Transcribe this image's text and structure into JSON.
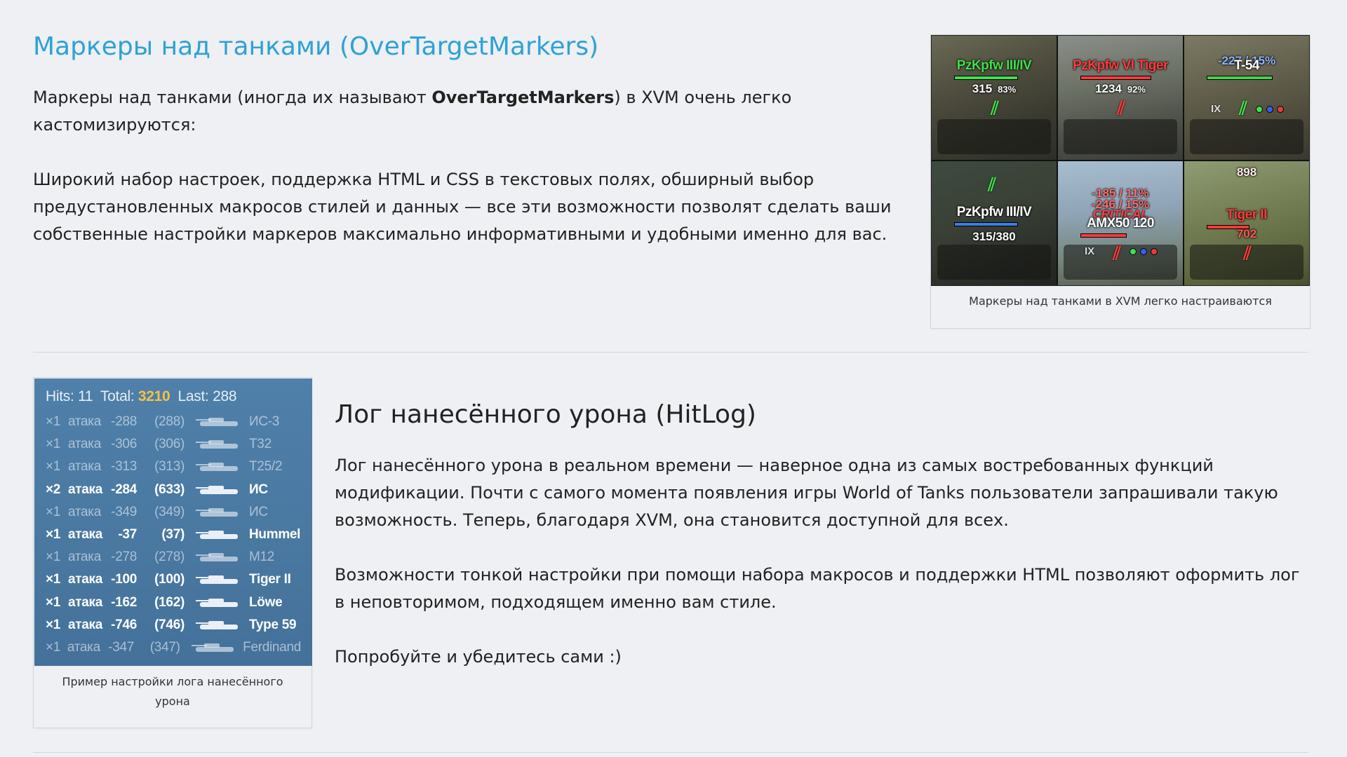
{
  "markers_section": {
    "title": "Маркеры над танками (OverTargetMarkers)",
    "para1_before": "Маркеры над танками (иногда их называют ",
    "para1_bold": "OverTargetMarkers",
    "para1_after": ") в XVM очень легко кастомизируются:",
    "para2": "Широкий набор настроек, поддержка HTML и CSS в текстовых полях, обширный выбор предустановленных макросов стилей и данных — все эти возможности позволят сделать ваши собственные настройки маркеров максимально информативными и удобными именно для вас.",
    "figure_caption": "Маркеры над танками в XVM легко настраиваются",
    "cells": [
      {
        "name": "PzKpfw III/IV",
        "sub": "315",
        "pct": "83%",
        "name_color": "#3fe04a",
        "bar_color": "#3fe04a",
        "bar_fill": 0.83
      },
      {
        "name": "PzKpfw VI Tiger",
        "sub": "1234",
        "pct": "92%",
        "name_color": "#ff3b3b",
        "bar_color": "#ff3b3b",
        "bar_fill": 0.92
      },
      {
        "name": "T-54",
        "sub": "-227 / 15%",
        "pct": "",
        "name_color": "#ffffff",
        "bar_color": "#49d04a",
        "bar_fill": 0.85,
        "tier": "IX"
      },
      {
        "name": "PzKpfw III/IV",
        "sub": "315/380",
        "pct": "",
        "name_color": "#ffffff",
        "bar_color": "#3b7fe8",
        "bar_fill": 0.83
      },
      {
        "name": "AMX50 120",
        "sub": "-185 / 11%",
        "sub2": "-246 / 15%",
        "crit": "CRITICAL",
        "pct": "",
        "name_color": "#ffffff",
        "bar_color": "#ff3b3b",
        "bar_fill": 0.6,
        "tier": "IX"
      },
      {
        "name": "Tiger II",
        "sub": "898",
        "sub2": "702",
        "pct": "",
        "name_color": "#ff3b3b",
        "bar_color": "#ff3b3b",
        "bar_fill": 0.55
      }
    ]
  },
  "hitlog_section": {
    "title": "Лог нанесённого урона (HitLog)",
    "para1": "Лог нанесённого урона в реальном времени — наверное одна из самых востребованных функций модификации. Почти с самого момента появления игры World of Tanks пользователи запрашивали такую возможность. Теперь, благодаря XVM, она становится доступной для всех.",
    "para2": "Возможности тонкой настройки при помощи набора макросов и поддержки HTML позволяют оформить лог в неповторимом, подходящем именно вам стиле.",
    "para3": "Попробуйте и убедитесь сами :)",
    "figure_caption": "Пример настройки лога нанесённого урона",
    "header": {
      "hits_label": "Hits:",
      "hits": "11",
      "total_label": "Total:",
      "total": "3210",
      "last_label": "Last:",
      "last": "288"
    },
    "rows": [
      {
        "mult": "×1",
        "word": "атака",
        "dmg": "-288",
        "total": "(288)",
        "tank": "ИС-3",
        "hi": false
      },
      {
        "mult": "×1",
        "word": "атака",
        "dmg": "-306",
        "total": "(306)",
        "tank": "T32",
        "hi": false
      },
      {
        "mult": "×1",
        "word": "атака",
        "dmg": "-313",
        "total": "(313)",
        "tank": "T25/2",
        "hi": false
      },
      {
        "mult": "×2",
        "word": "атака",
        "dmg": "-284",
        "total": "(633)",
        "tank": "ИС",
        "hi": true
      },
      {
        "mult": "×1",
        "word": "атака",
        "dmg": "-349",
        "total": "(349)",
        "tank": "ИС",
        "hi": false
      },
      {
        "mult": "×1",
        "word": "атака",
        "dmg": "-37",
        "total": "(37)",
        "tank": "Hummel",
        "hi": true
      },
      {
        "mult": "×1",
        "word": "атака",
        "dmg": "-278",
        "total": "(278)",
        "tank": "M12",
        "hi": false
      },
      {
        "mult": "×1",
        "word": "атака",
        "dmg": "-100",
        "total": "(100)",
        "tank": "Tiger II",
        "hi": true
      },
      {
        "mult": "×1",
        "word": "атака",
        "dmg": "-162",
        "total": "(162)",
        "tank": "Löwe",
        "hi": true
      },
      {
        "mult": "×1",
        "word": "атака",
        "dmg": "-746",
        "total": "(746)",
        "tank": "Type 59",
        "hi": true
      },
      {
        "mult": "×1",
        "word": "атака",
        "dmg": "-347",
        "total": "(347)",
        "tank": "Ferdinand",
        "hi": false
      }
    ]
  },
  "colors": {
    "link_title": "#2fa1d6",
    "hitlog_bg": "#4a79a2",
    "hitlog_total": "#f3c245"
  }
}
